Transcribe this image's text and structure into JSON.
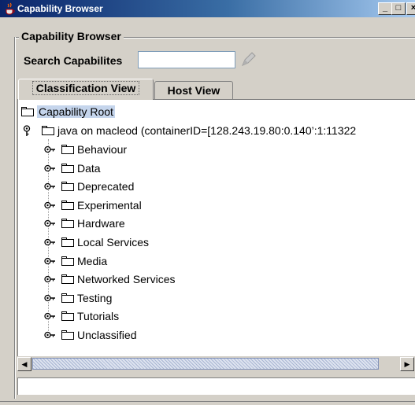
{
  "window": {
    "title": "Capability Browser",
    "minimize_label": "_",
    "maximize_label": "□",
    "close_label": "×"
  },
  "group": {
    "title": "Capability Browser"
  },
  "search": {
    "label": "Search Capabilites",
    "value": "",
    "placeholder": ""
  },
  "tabs": [
    {
      "label": "Classification View",
      "active": true
    },
    {
      "label": "Host View",
      "active": false
    }
  ],
  "tree": {
    "root": {
      "label": "Capability Root",
      "selected": true
    },
    "host": {
      "label": "java on macleod (containerID=[128.243.19.80:0.140’:1:11322",
      "expanded": true
    },
    "items": [
      {
        "label": "Behaviour"
      },
      {
        "label": "Data"
      },
      {
        "label": "Deprecated"
      },
      {
        "label": "Experimental"
      },
      {
        "label": "Hardware"
      },
      {
        "label": "Local Services"
      },
      {
        "label": "Media"
      },
      {
        "label": "Networked Services"
      },
      {
        "label": "Testing"
      },
      {
        "label": "Tutorials"
      },
      {
        "label": "Unclassified"
      }
    ]
  },
  "scrollbar": {
    "left_arrow": "◀",
    "right_arrow": "▶"
  },
  "status": {
    "text": ""
  },
  "icons": {
    "app": "java-cup-icon",
    "folder": "folder-icon",
    "expand": "key-expander-icon",
    "search_button": "pencil-icon"
  },
  "colors": {
    "titlebar_start": "#0a246a",
    "titlebar_end": "#a6caf0",
    "background": "#d4d0c8",
    "selection": "#c5d5ec"
  }
}
